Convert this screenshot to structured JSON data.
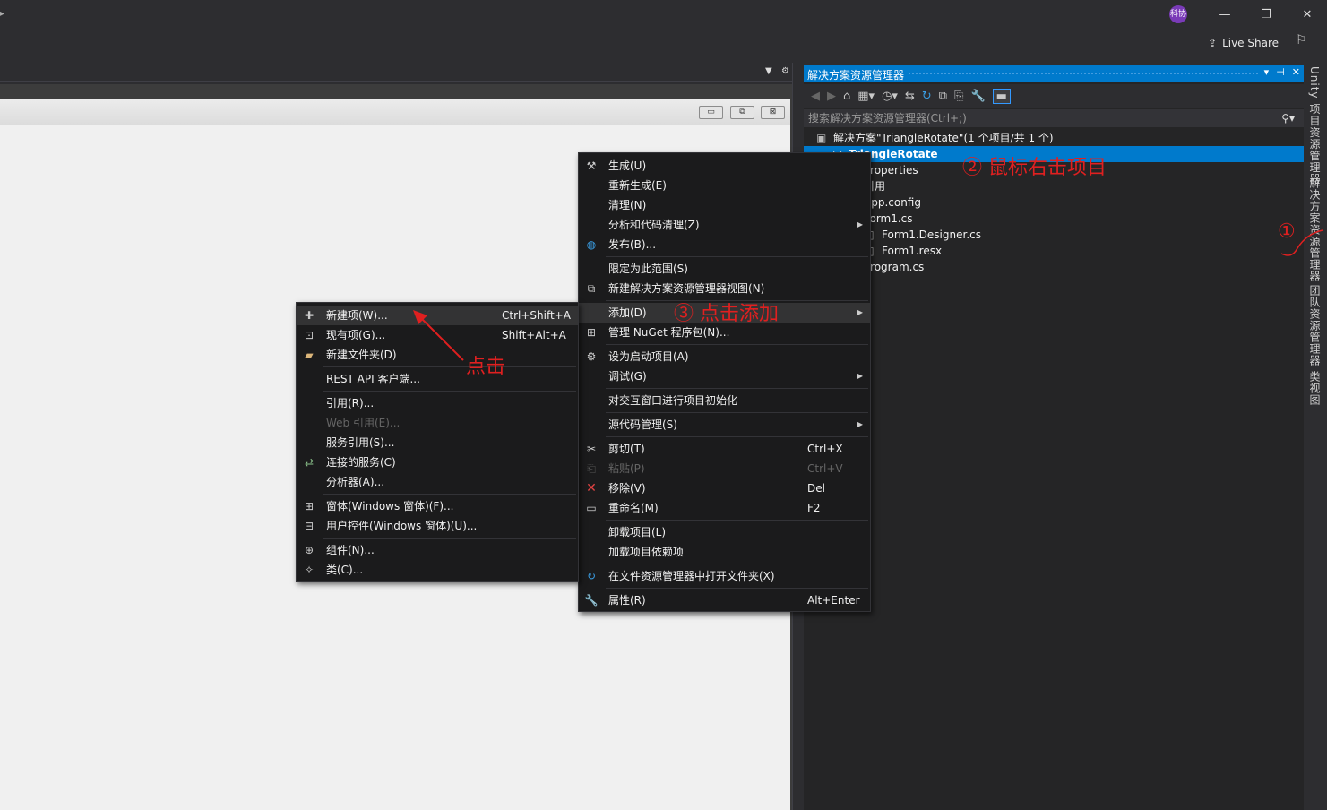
{
  "title_bar": {
    "avatar": "科协",
    "live_share": "Live Share",
    "minimize_icon": "minimize-icon",
    "restore_icon": "restore-icon",
    "close_icon": "close-icon"
  },
  "designer": {
    "mdi_buttons": [
      "▭",
      "⧉",
      "⊠"
    ]
  },
  "solution_explorer": {
    "title": "解决方案资源管理器",
    "search_placeholder": "搜索解决方案资源管理器(Ctrl+;)",
    "tree": [
      {
        "label": "解决方案\"TriangleRotate\"(1 个项目/共 1 个)",
        "selected": false
      },
      {
        "label": "TriangleRotate",
        "selected": true
      },
      {
        "label": "Properties",
        "selected": false
      },
      {
        "label": "引用",
        "selected": false
      },
      {
        "label": "App.config",
        "selected": false
      },
      {
        "label": "Form1.cs",
        "selected": false
      },
      {
        "label": "Form1.Designer.cs",
        "selected": false
      },
      {
        "label": "Form1.resx",
        "selected": false
      },
      {
        "label": "Program.cs",
        "selected": false
      }
    ]
  },
  "side_tabs": [
    "Unity 项目资源管理器",
    "解决方案资源管理器",
    "团队资源管理器",
    "类视图"
  ],
  "context_menu": {
    "items": [
      {
        "label": "生成(U)",
        "icon": "build-icon"
      },
      {
        "label": "重新生成(E)"
      },
      {
        "label": "清理(N)"
      },
      {
        "label": "分析和代码清理(Z)",
        "submenu": true
      },
      {
        "label": "发布(B)...",
        "icon": "globe-icon"
      },
      {
        "label": "限定为此范围(S)"
      },
      {
        "label": "新建解决方案资源管理器视图(N)",
        "icon": "new-view-icon"
      },
      {
        "label": "添加(D)",
        "submenu": true,
        "highlighted": true
      },
      {
        "label": "管理 NuGet 程序包(N)...",
        "icon": "nuget-icon"
      },
      {
        "label": "设为启动项目(A)",
        "icon": "gear-icon"
      },
      {
        "label": "调试(G)",
        "submenu": true
      },
      {
        "label": "对交互窗口进行项目初始化"
      },
      {
        "label": "源代码管理(S)",
        "submenu": true
      },
      {
        "label": "剪切(T)",
        "shortcut": "Ctrl+X",
        "icon": "cut-icon"
      },
      {
        "label": "粘贴(P)",
        "shortcut": "Ctrl+V",
        "icon": "paste-icon",
        "disabled": true
      },
      {
        "label": "移除(V)",
        "shortcut": "Del",
        "icon": "remove-icon"
      },
      {
        "label": "重命名(M)",
        "shortcut": "F2",
        "icon": "rename-icon"
      },
      {
        "label": "卸载项目(L)"
      },
      {
        "label": "加载项目依赖项"
      },
      {
        "label": "在文件资源管理器中打开文件夹(X)",
        "icon": "refresh-folder-icon"
      },
      {
        "label": "属性(R)",
        "shortcut": "Alt+Enter",
        "icon": "wrench-icon"
      }
    ]
  },
  "add_submenu": {
    "items": [
      {
        "label": "新建项(W)...",
        "shortcut": "Ctrl+Shift+A",
        "icon": "new-item-icon"
      },
      {
        "label": "现有项(G)...",
        "shortcut": "Shift+Alt+A",
        "icon": "existing-item-icon"
      },
      {
        "label": "新建文件夹(D)",
        "icon": "folder-icon"
      },
      {
        "label": "REST API 客户端..."
      },
      {
        "label": "引用(R)..."
      },
      {
        "label": "Web 引用(E)...",
        "disabled": true
      },
      {
        "label": "服务引用(S)..."
      },
      {
        "label": "连接的服务(C)",
        "icon": "connected-service-icon"
      },
      {
        "label": "分析器(A)..."
      },
      {
        "label": "窗体(Windows 窗体)(F)...",
        "icon": "form-icon"
      },
      {
        "label": "用户控件(Windows 窗体)(U)...",
        "icon": "user-control-icon"
      },
      {
        "label": "组件(N)...",
        "icon": "component-icon"
      },
      {
        "label": "类(C)...",
        "icon": "class-icon"
      }
    ]
  },
  "annotations": {
    "step1": "①",
    "step2": "②  鼠标右击项目",
    "step3": "③  点击添加",
    "click": "点击"
  },
  "colors": {
    "accent": "#007acc",
    "annotation": "#e02020"
  }
}
